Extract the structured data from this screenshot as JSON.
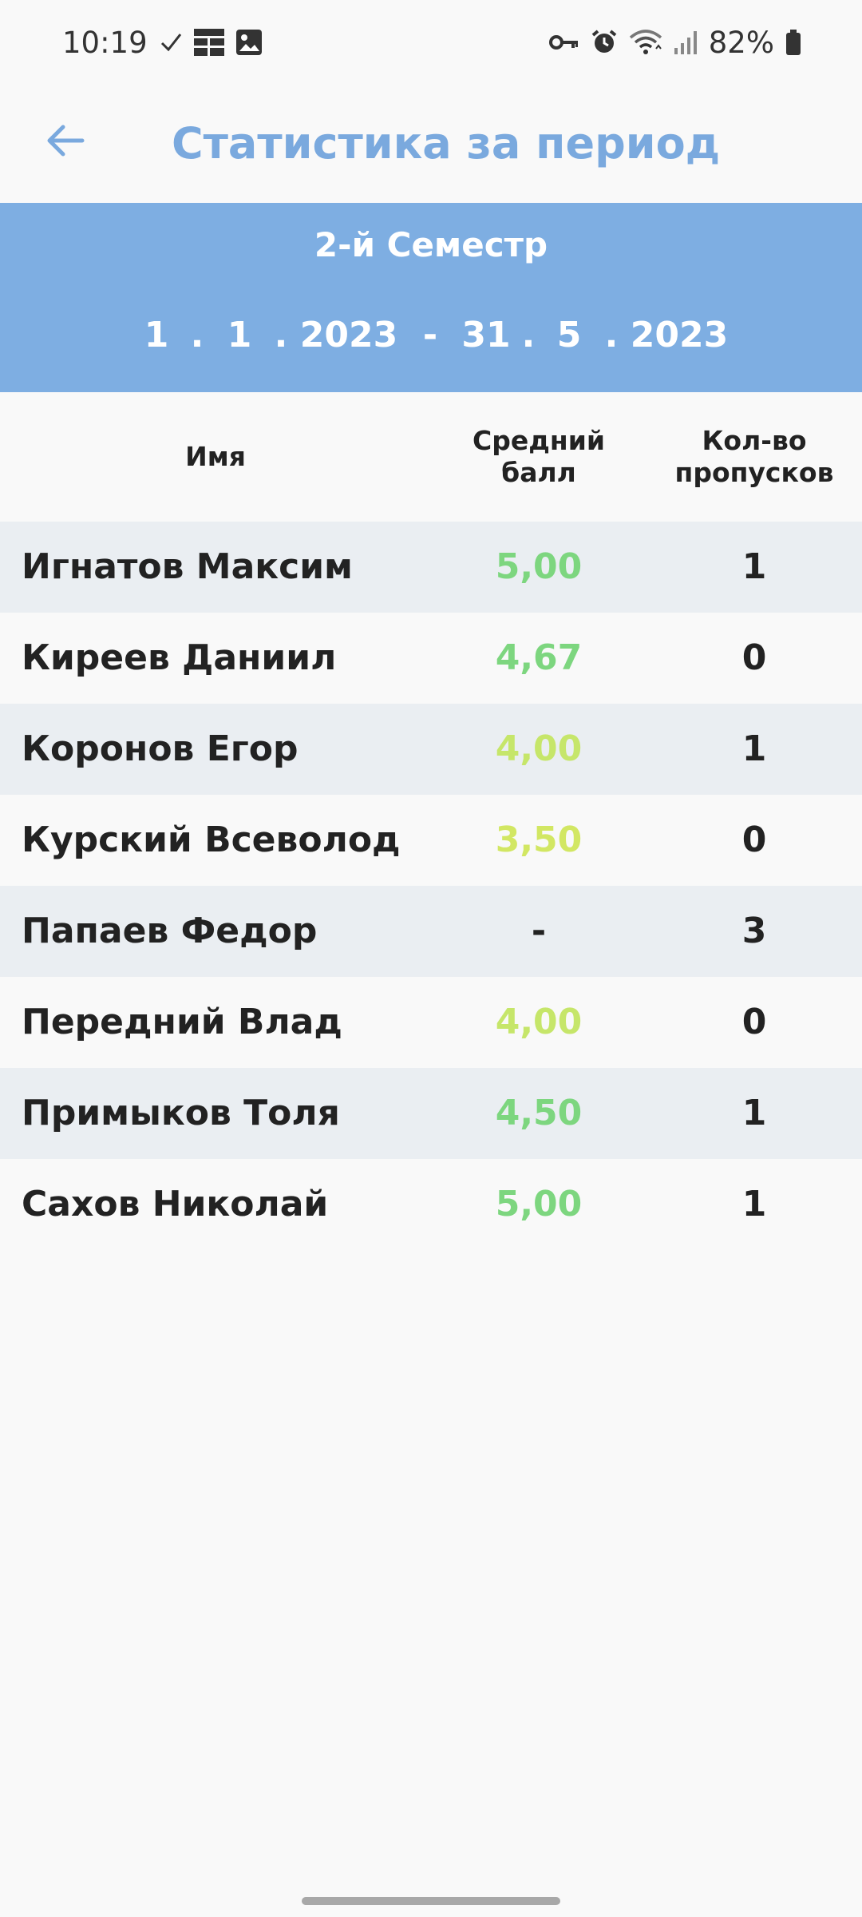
{
  "status_bar": {
    "time": "10:19",
    "battery": "82%",
    "icons": [
      "check-icon",
      "grid-notification-icon",
      "image-icon",
      "vpn-key-icon",
      "alarm-icon",
      "wifi-icon",
      "signal-icon",
      "battery-icon"
    ]
  },
  "header": {
    "title": "Статистика за период",
    "back_icon": "arrow-left-icon"
  },
  "period": {
    "name": "2-й Семестр",
    "start": {
      "day": "1",
      "month": "1",
      "year": "2023"
    },
    "end": {
      "day": "31",
      "month": "5",
      "year": "2023"
    },
    "date_separator": ".",
    "range_separator": "-"
  },
  "columns": {
    "name": "Имя",
    "grade": "Средний балл",
    "absences": "Кол-во пропусков"
  },
  "rows": [
    {
      "name": "Игнатов Максим",
      "grade": "5,00",
      "absences": "1",
      "grade_color": "#7dd67f"
    },
    {
      "name": "Киреев Даниил",
      "grade": "4,67",
      "absences": "0",
      "grade_color": "#7dd67f"
    },
    {
      "name": "Коронов Егор",
      "grade": "4,00",
      "absences": "1",
      "grade_color": "#c6e66a"
    },
    {
      "name": "Курский Всеволод",
      "grade": "3,50",
      "absences": "0",
      "grade_color": "#d2e763"
    },
    {
      "name": "Папаев Федор",
      "grade": "-",
      "absences": "3",
      "grade_color": "#222222"
    },
    {
      "name": "Передний Влад",
      "grade": "4,00",
      "absences": "0",
      "grade_color": "#c6e66a"
    },
    {
      "name": "Примыков Толя",
      "grade": "4,50",
      "absences": "1",
      "grade_color": "#7dd67f"
    },
    {
      "name": "Сахов Николай",
      "grade": "5,00",
      "absences": "1",
      "grade_color": "#7dd67f"
    }
  ],
  "colors": {
    "accent": "#7aa9de",
    "period_bg": "#7eaee2",
    "row_shade": "#eaeef2",
    "background": "#f9f9f9"
  }
}
